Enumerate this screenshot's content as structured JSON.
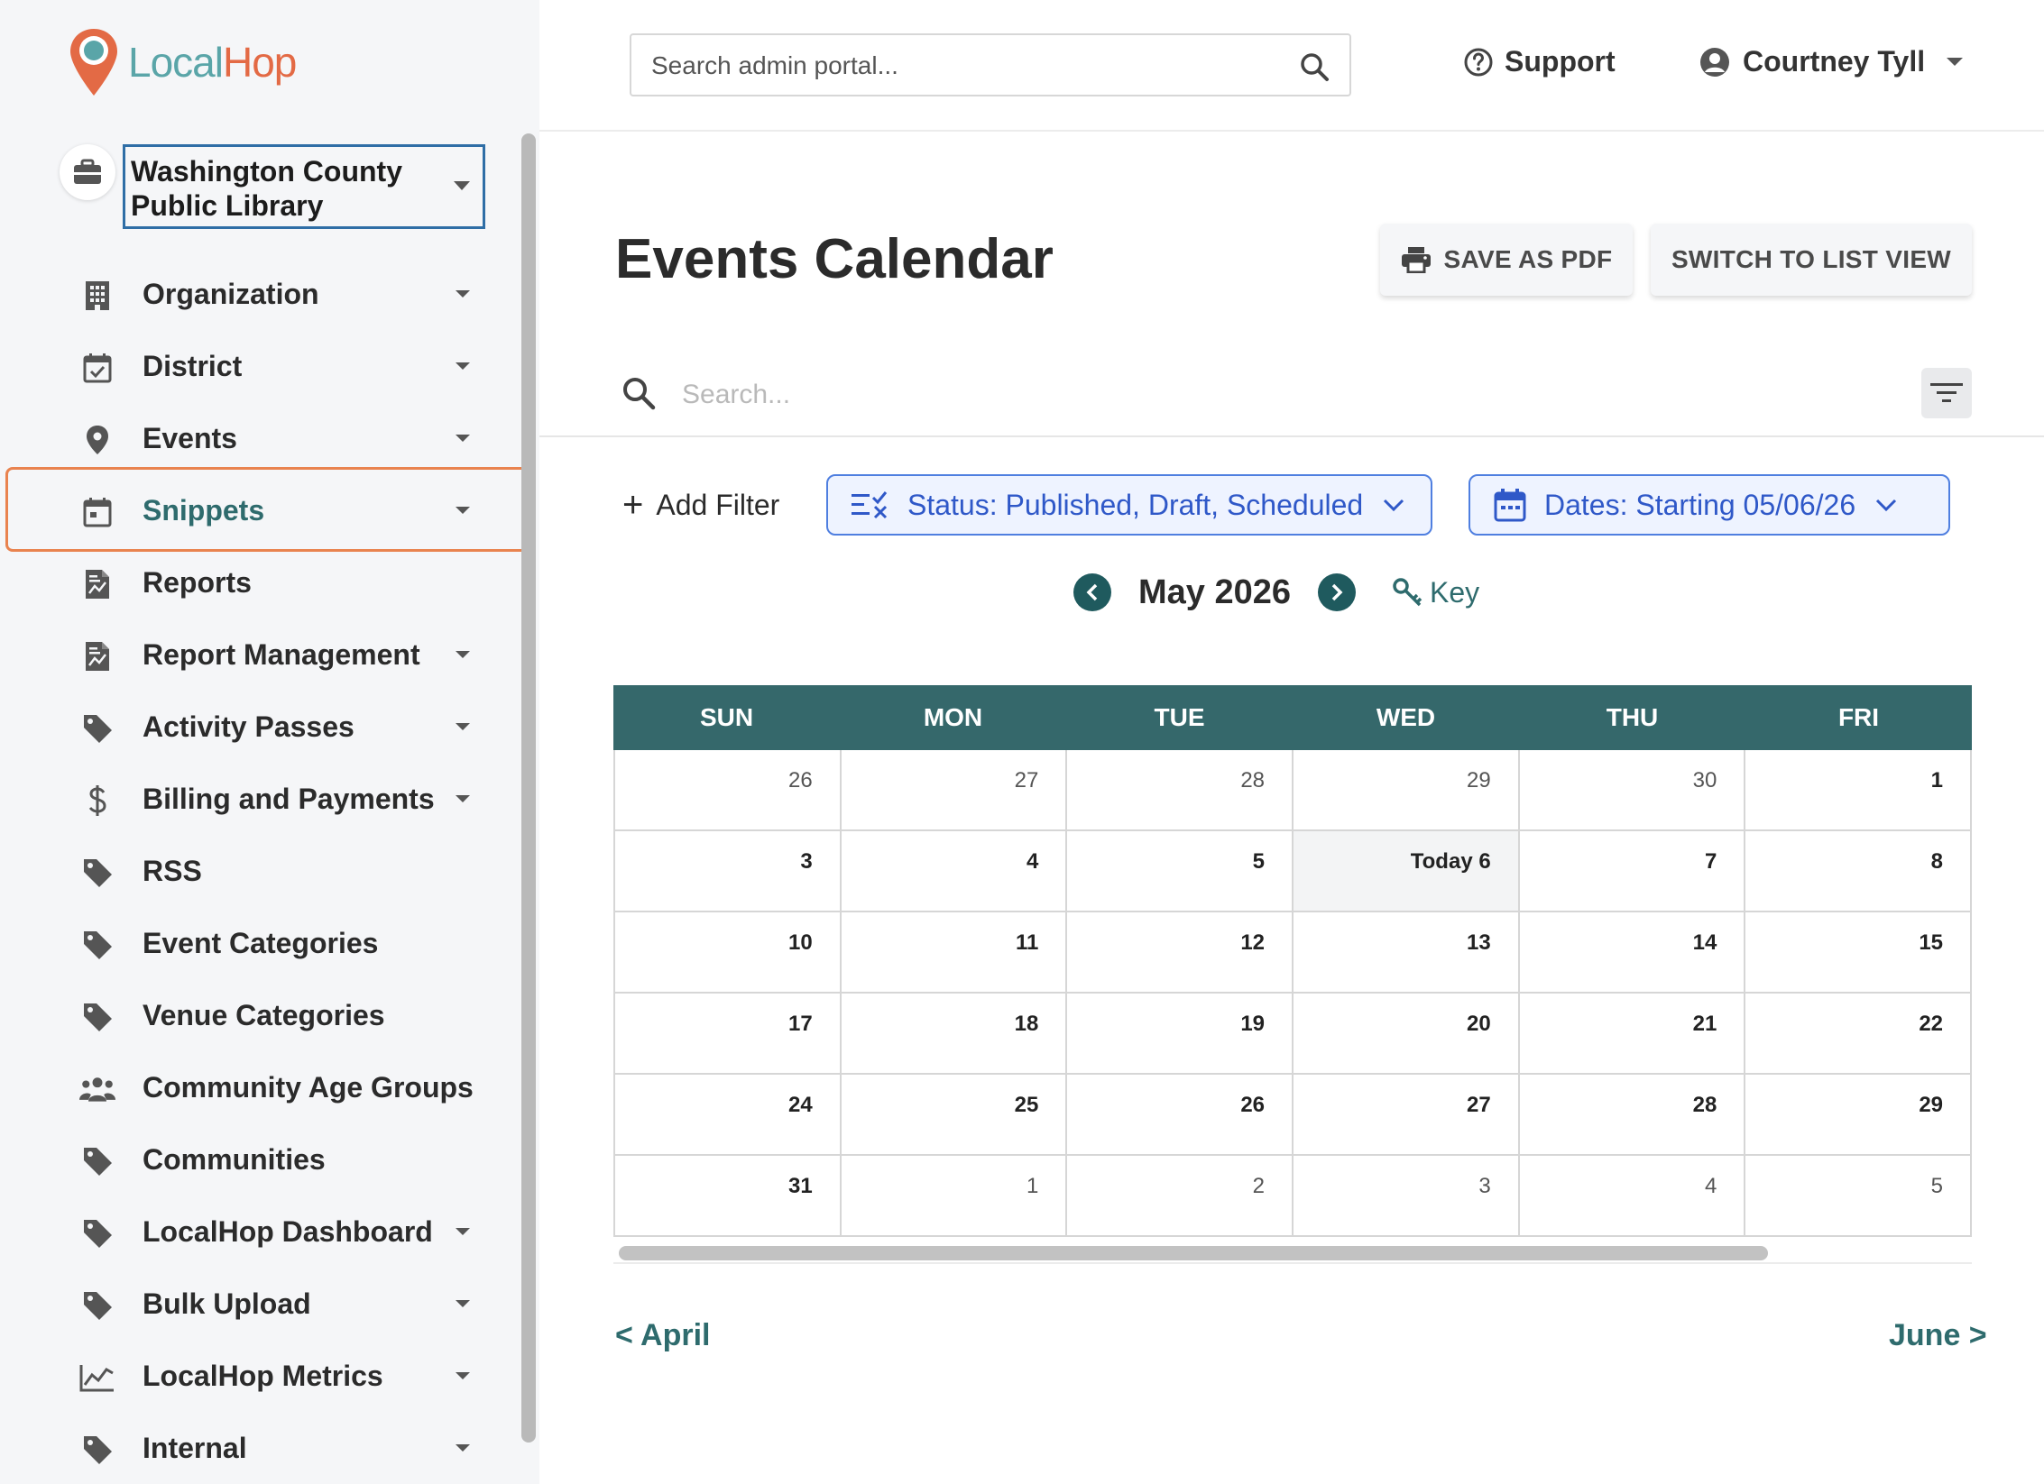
{
  "app": {
    "logo_local": "Local",
    "logo_hop": "Hop",
    "colors": {
      "teal": "#35686b",
      "accent": "#e36a45",
      "link": "#2e6b6d",
      "chip_blue": "#2f58c8"
    }
  },
  "header": {
    "search_placeholder": "Search admin portal...",
    "support_label": "Support",
    "user_name": "Courtney Tyll"
  },
  "sidebar": {
    "org_name": "Washington County Public Library",
    "items": [
      {
        "label": "Organization",
        "icon": "building-icon",
        "has_caret": true
      },
      {
        "label": "District",
        "icon": "calendar-check-icon",
        "has_caret": true
      },
      {
        "label": "Events",
        "icon": "map-pin-icon",
        "has_caret": true
      },
      {
        "label": "Snippets",
        "icon": "calendar-icon",
        "has_caret": true,
        "selected": true
      },
      {
        "label": "Reports",
        "icon": "report-icon",
        "has_caret": false
      },
      {
        "label": "Report Management",
        "icon": "report-icon",
        "has_caret": true
      },
      {
        "label": "Activity Passes",
        "icon": "tag-icon",
        "has_caret": true
      },
      {
        "label": "Billing and Payments",
        "icon": "dollar-icon",
        "has_caret": true
      },
      {
        "label": "RSS",
        "icon": "tag-icon",
        "has_caret": false
      },
      {
        "label": "Event Categories",
        "icon": "tag-icon",
        "has_caret": false
      },
      {
        "label": "Venue Categories",
        "icon": "tag-icon",
        "has_caret": false
      },
      {
        "label": "Community Age Groups",
        "icon": "users-icon",
        "has_caret": false
      },
      {
        "label": "Communities",
        "icon": "tag-icon",
        "has_caret": false
      },
      {
        "label": "LocalHop Dashboard",
        "icon": "tag-icon",
        "has_caret": true
      },
      {
        "label": "Bulk Upload",
        "icon": "tag-icon",
        "has_caret": true
      },
      {
        "label": "LocalHop Metrics",
        "icon": "chart-line-icon",
        "has_caret": true
      },
      {
        "label": "Internal",
        "icon": "tag-icon",
        "has_caret": true
      }
    ]
  },
  "main": {
    "title": "Events Calendar",
    "save_pdf_label": "SAVE AS PDF",
    "list_view_label": "SWITCH TO LIST VIEW",
    "search_placeholder": "Search...",
    "add_filter_label": "Add Filter",
    "status_filter": "Status: Published, Draft, Scheduled",
    "dates_filter": "Dates: Starting 05/06/26",
    "month_label": "May 2026",
    "key_label": "Key",
    "prev_month_label": "< April",
    "next_month_label": "June >"
  },
  "calendar": {
    "days_of_week": [
      "SUN",
      "MON",
      "TUE",
      "WED",
      "THU",
      "FRI"
    ],
    "weeks": [
      [
        {
          "label": "26",
          "current": false
        },
        {
          "label": "27",
          "current": false
        },
        {
          "label": "28",
          "current": false
        },
        {
          "label": "29",
          "current": false
        },
        {
          "label": "30",
          "current": false
        },
        {
          "label": "1",
          "current": true
        }
      ],
      [
        {
          "label": "3",
          "current": true
        },
        {
          "label": "4",
          "current": true
        },
        {
          "label": "5",
          "current": true
        },
        {
          "label": "Today 6",
          "current": true,
          "today": true
        },
        {
          "label": "7",
          "current": true
        },
        {
          "label": "8",
          "current": true
        }
      ],
      [
        {
          "label": "10",
          "current": true
        },
        {
          "label": "11",
          "current": true
        },
        {
          "label": "12",
          "current": true
        },
        {
          "label": "13",
          "current": true
        },
        {
          "label": "14",
          "current": true
        },
        {
          "label": "15",
          "current": true
        }
      ],
      [
        {
          "label": "17",
          "current": true
        },
        {
          "label": "18",
          "current": true
        },
        {
          "label": "19",
          "current": true
        },
        {
          "label": "20",
          "current": true
        },
        {
          "label": "21",
          "current": true
        },
        {
          "label": "22",
          "current": true
        }
      ],
      [
        {
          "label": "24",
          "current": true
        },
        {
          "label": "25",
          "current": true
        },
        {
          "label": "26",
          "current": true
        },
        {
          "label": "27",
          "current": true
        },
        {
          "label": "28",
          "current": true
        },
        {
          "label": "29",
          "current": true
        }
      ],
      [
        {
          "label": "31",
          "current": true
        },
        {
          "label": "1",
          "current": false
        },
        {
          "label": "2",
          "current": false
        },
        {
          "label": "3",
          "current": false
        },
        {
          "label": "4",
          "current": false
        },
        {
          "label": "5",
          "current": false
        }
      ]
    ]
  }
}
